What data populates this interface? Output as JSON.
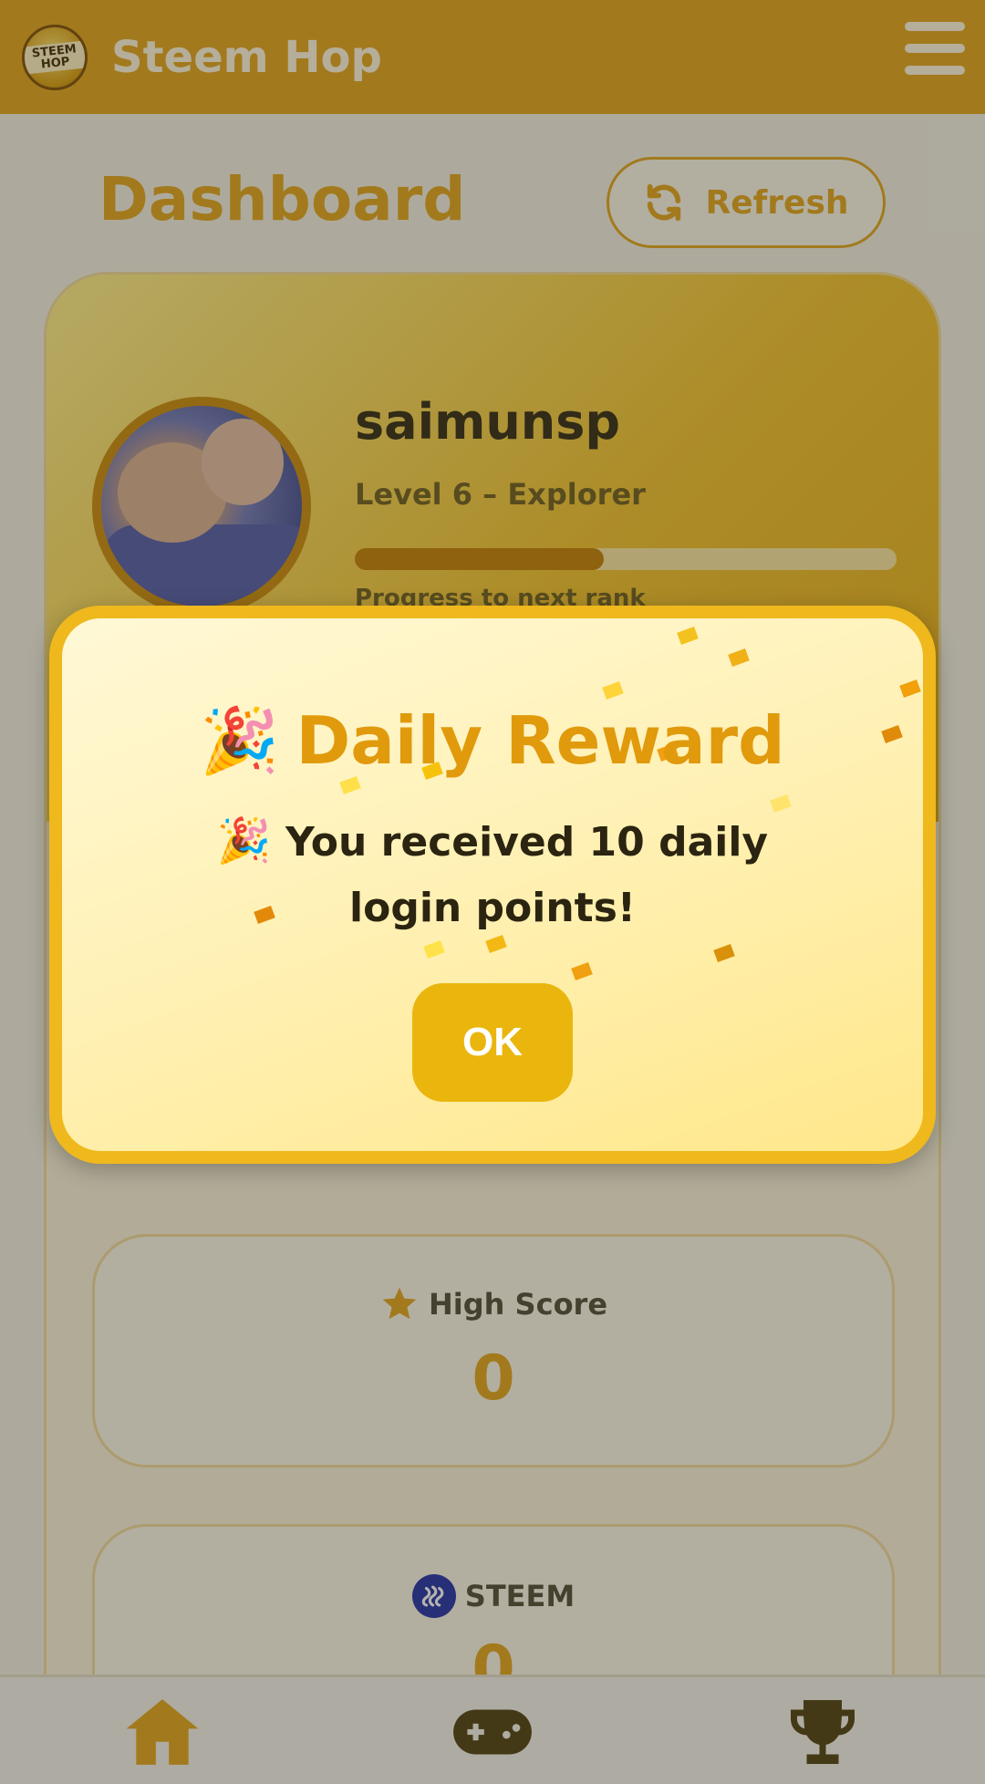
{
  "header": {
    "logo_text": "STEEM HOP",
    "title": "Steem Hop"
  },
  "dashboard": {
    "title": "Dashboard",
    "refresh_label": "Refresh"
  },
  "profile": {
    "username": "saimunsp",
    "level": "Level 6 – Explorer",
    "progress_label": "Progress to next rank",
    "progress_fraction": 0.46
  },
  "stats": {
    "high_score_label": "High Score",
    "high_score_value": "0",
    "steem_label": "STEEM",
    "steem_value": "0"
  },
  "modal": {
    "title_emoji": "🎉",
    "title": "Daily Reward",
    "message_emoji": "🎉",
    "message": "You received 10 daily login points!",
    "ok_label": "OK"
  },
  "colors": {
    "brand": "#e0a317",
    "modal_border": "#efb81c",
    "ok_button": "#eab60e",
    "steem_icon": "#1b2aa8"
  },
  "icons": {
    "nav": [
      "home-icon",
      "gamepad-icon",
      "trophy-icon"
    ]
  }
}
